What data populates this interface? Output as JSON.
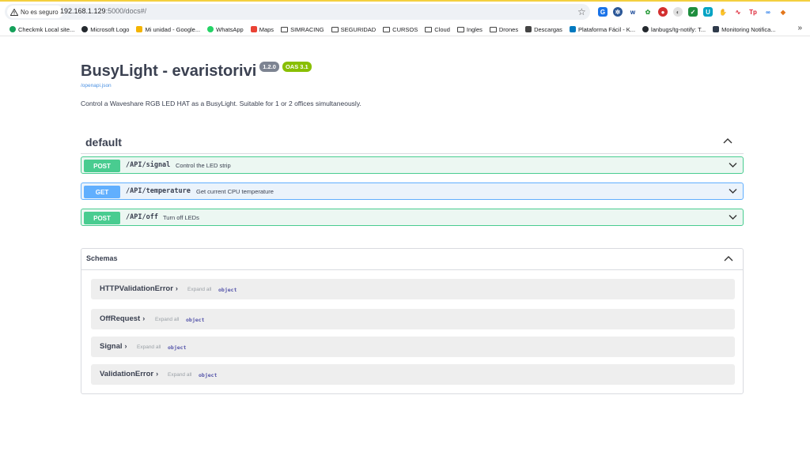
{
  "browser": {
    "security_chip": "No es seguro",
    "url_host": "192.168.1.129",
    "url_rest": ":5000/docs#/",
    "bookmarks": [
      {
        "label": "Checkmk Local site...",
        "icon": "checkmk-icon"
      },
      {
        "label": "Microsoft Logo",
        "icon": "github-icon"
      },
      {
        "label": "Mi unidad - Google...",
        "icon": "drive-icon"
      },
      {
        "label": "WhatsApp",
        "icon": "whatsapp-icon"
      },
      {
        "label": "Maps",
        "icon": "maps-icon"
      },
      {
        "label": "SIMRACING",
        "icon": "folder-icon"
      },
      {
        "label": "SEGURIDAD",
        "icon": "folder-icon"
      },
      {
        "label": "CURSOS",
        "icon": "folder-icon"
      },
      {
        "label": "Cloud",
        "icon": "folder-icon"
      },
      {
        "label": "Ingles",
        "icon": "folder-icon"
      },
      {
        "label": "Drones",
        "icon": "folder-icon"
      },
      {
        "label": "Descargas",
        "icon": "download-icon"
      },
      {
        "label": "Plataforma Fácil - K...",
        "icon": "trello-icon"
      },
      {
        "label": "lanbugs/tg-notify: T...",
        "icon": "github-icon"
      },
      {
        "label": "Monitoring Notifica...",
        "icon": "monitoring-icon"
      }
    ],
    "more_bookmarks": "»"
  },
  "api": {
    "title": "BusyLight - evaristorivi",
    "version": "1.2.0",
    "oas": "OAS 3.1",
    "spec_link": "/openapi.json",
    "description": "Control a Waveshare RGB LED HAT as a BusyLight. Suitable for 1 or 2 offices simultaneously."
  },
  "tag": {
    "name": "default",
    "operations": [
      {
        "method": "POST",
        "path": "/API/signal",
        "summary": "Control the LED strip"
      },
      {
        "method": "GET",
        "path": "/API/temperature",
        "summary": "Get current CPU temperature"
      },
      {
        "method": "POST",
        "path": "/API/off",
        "summary": "Turn off LEDs"
      }
    ]
  },
  "schemas": {
    "title": "Schemas",
    "expand_label": "Expand all",
    "models": [
      {
        "name": "HTTPValidationError",
        "type": "object"
      },
      {
        "name": "OffRequest",
        "type": "object"
      },
      {
        "name": "Signal",
        "type": "object"
      },
      {
        "name": "ValidationError",
        "type": "object"
      }
    ]
  },
  "colors": {
    "post": "#49cc90",
    "get": "#61affe",
    "version_badge": "#7d8492",
    "oas_badge": "#89bf04"
  }
}
